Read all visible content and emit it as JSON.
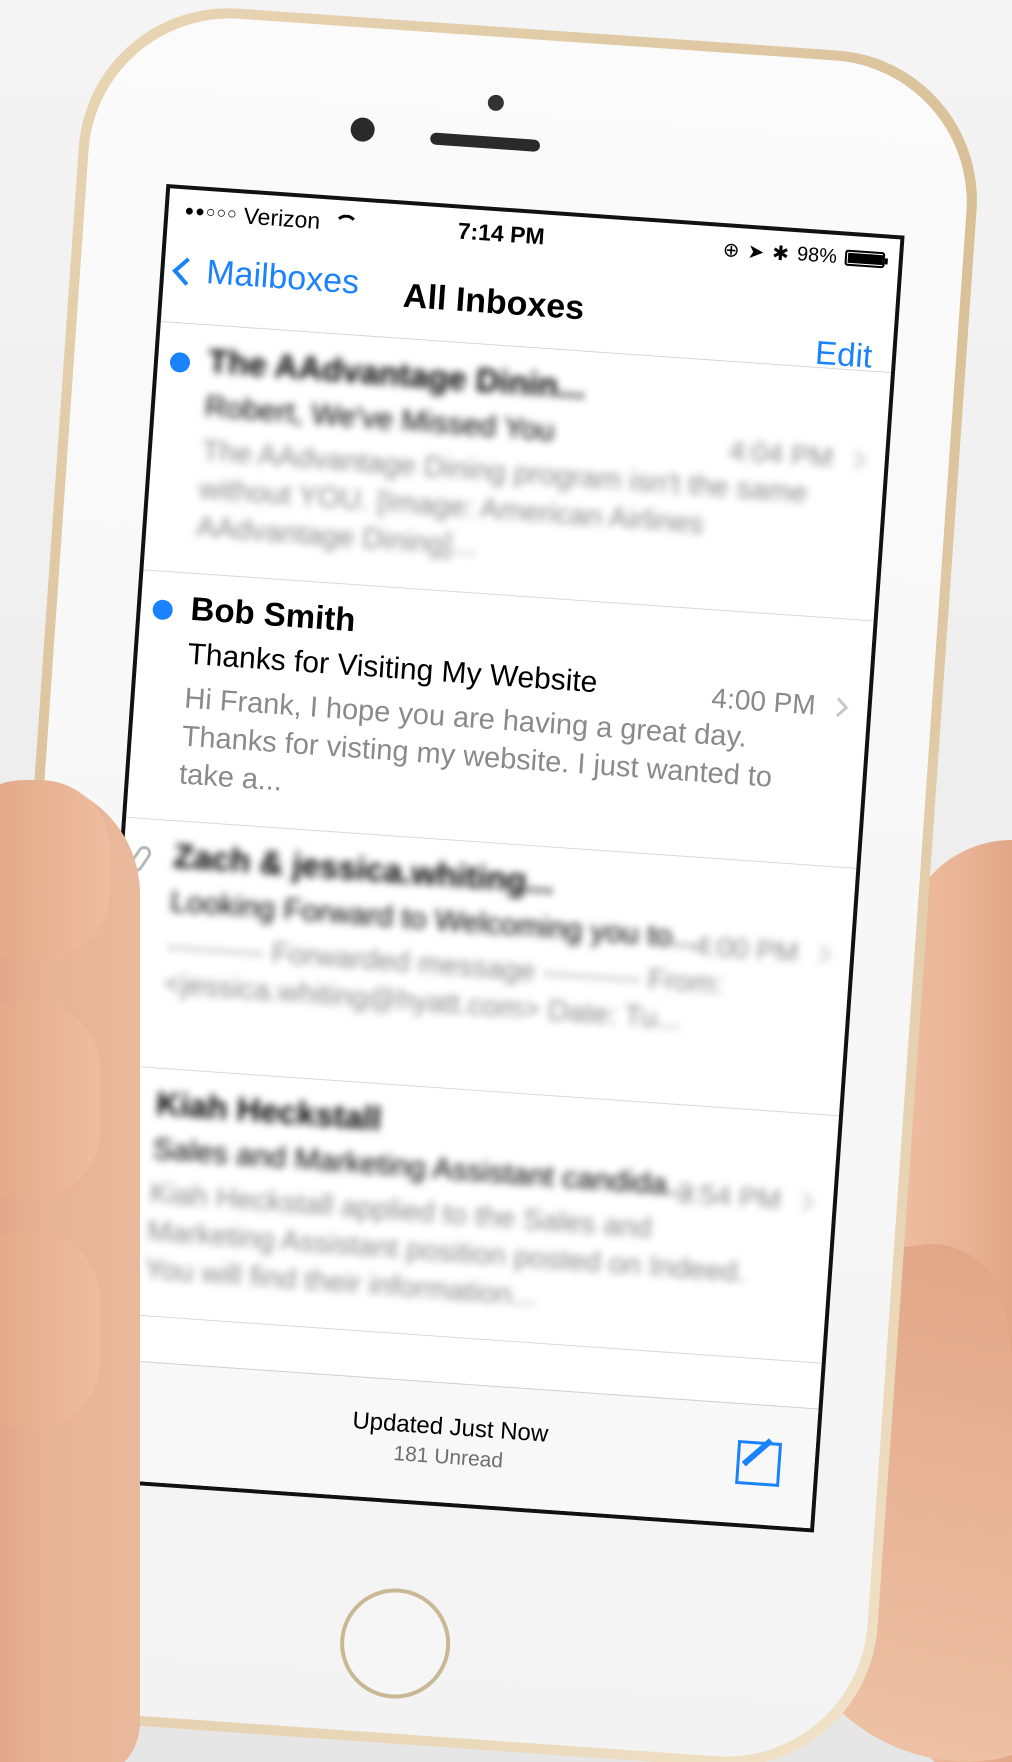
{
  "status_bar": {
    "signal": "●●○○○",
    "carrier": "Verizon",
    "time": "7:14 PM",
    "battery_percent": "98%",
    "battery_level": 0.98
  },
  "nav": {
    "back_label": "Mailboxes",
    "title": "All Inboxes",
    "edit_label": "Edit"
  },
  "mails": [
    {
      "sender": "The AAdvantage Dinin...",
      "subject": "Robert, We've Missed You",
      "time": "4:04 PM",
      "preview": "The AAdvantage Dining program isn't the same without YOU. [Image: American Airlines AAdvantage Dining]...",
      "unread": true,
      "attachment": false,
      "blurred": true
    },
    {
      "sender": "Bob Smith",
      "subject": "Thanks for Visiting My Website",
      "time": "4:00 PM",
      "preview": "Hi Frank, I hope you are having a great day. Thanks for visting my website. I just wanted to take a...",
      "unread": true,
      "attachment": false,
      "blurred": false
    },
    {
      "sender": "Zach & jessica.whiting...",
      "subject": "Looking Forward to Welcoming you to...",
      "time": "4:00 PM",
      "preview": "---------- Forwarded message ---------- From: <jessica.whiting@hyatt.com> Date: Tu...",
      "unread": false,
      "attachment": true,
      "blurred": true
    },
    {
      "sender": "Kiah Heckstall",
      "subject": "Sales and Marketing Assistant candida...",
      "time": "3:54 PM",
      "preview": "Kiah Heckstall applied to the Sales and Marketing Assistant position posted on Indeed. You will find their information...",
      "unread": true,
      "attachment": true,
      "blurred": true
    }
  ],
  "toolbar": {
    "updated": "Updated Just Now",
    "unread_count": "181 Unread"
  },
  "colors": {
    "accent": "#1a82fb",
    "phone_gold": "#d8bf96"
  }
}
